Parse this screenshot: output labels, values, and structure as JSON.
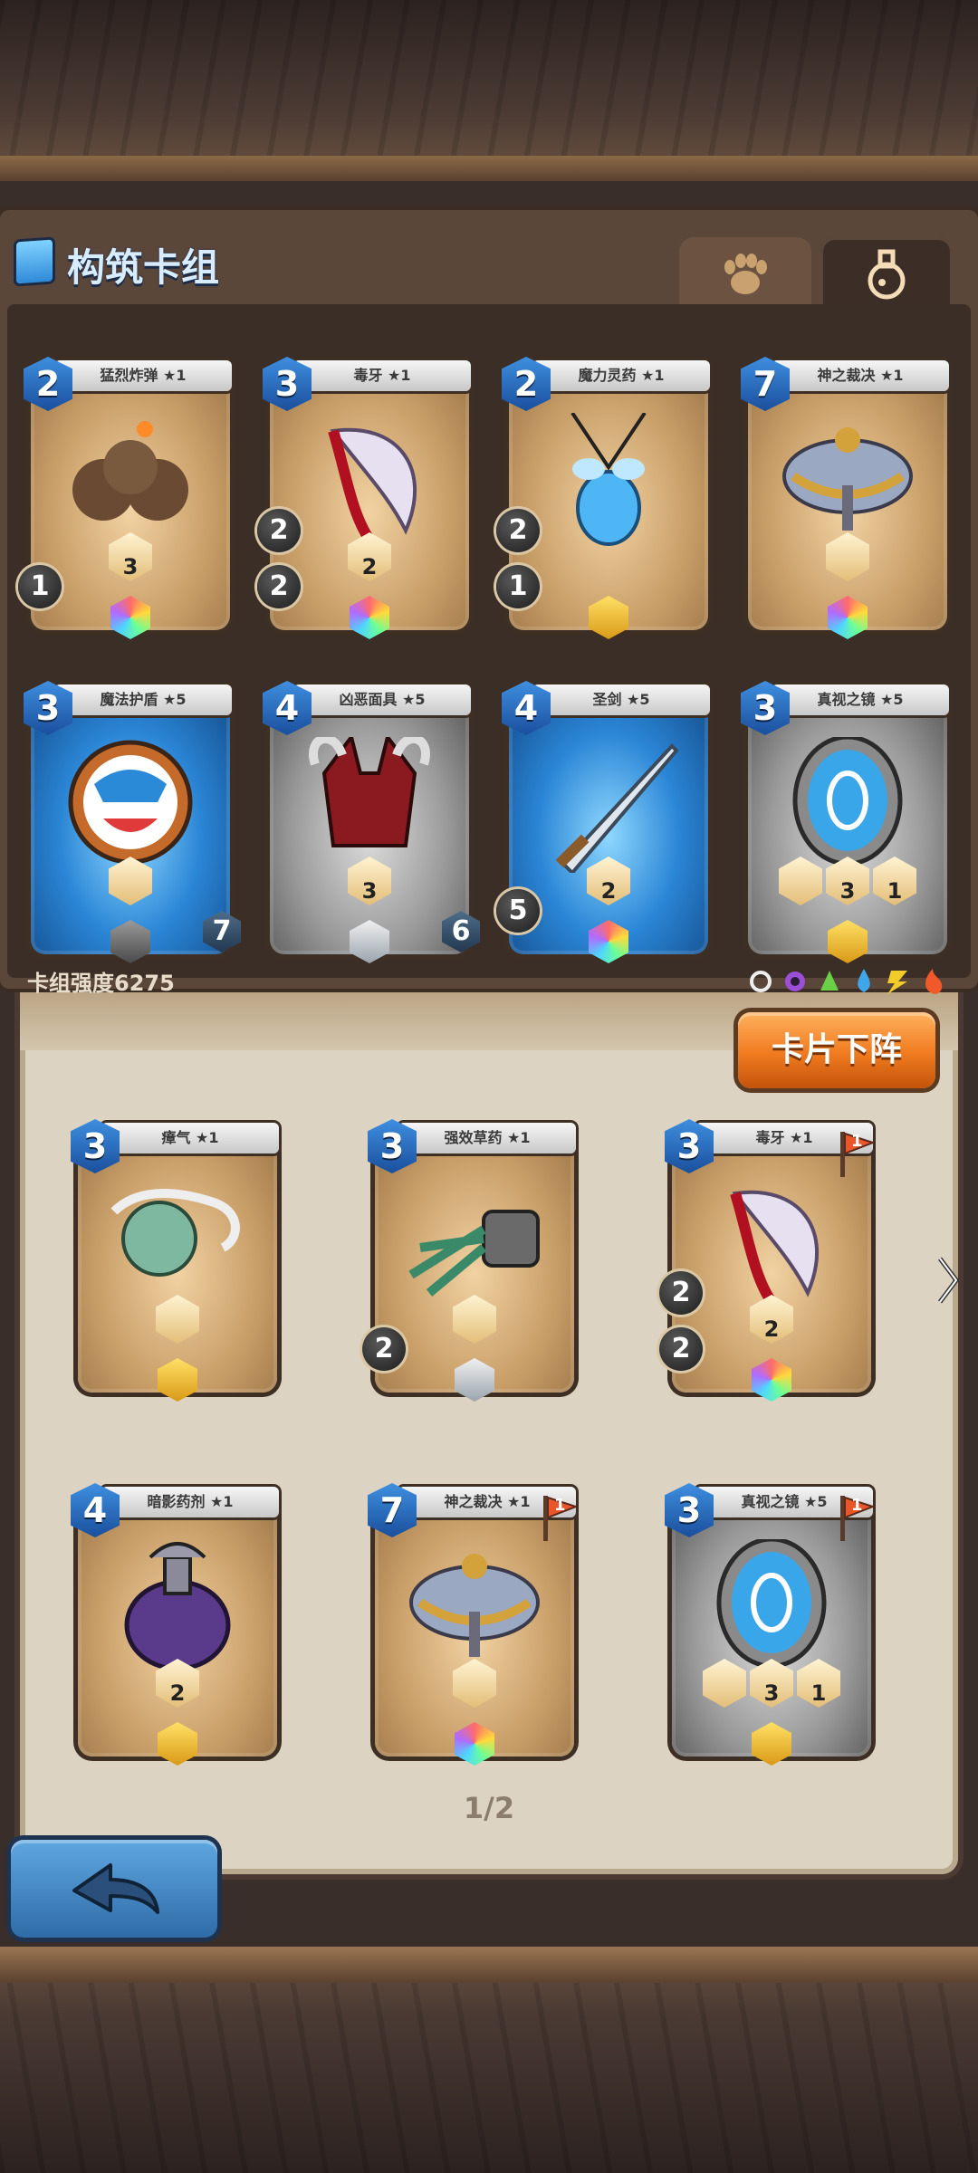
{
  "deck": {
    "title": "构筑卡组",
    "strength": "卡组强度6275",
    "tabs": [
      "paw",
      "potion"
    ],
    "cards": [
      {
        "name": "猛烈炸弹 ★1",
        "cost": "2",
        "frame": "gold",
        "gem": "rainbow",
        "art": "bombs",
        "stats": [
          "3"
        ],
        "left_rounds": [
          "1"
        ]
      },
      {
        "name": "毒牙 ★1",
        "cost": "3",
        "frame": "gold",
        "gem": "rainbow",
        "art": "fang",
        "stats": [
          "2"
        ],
        "left_rounds": [
          "2",
          "2"
        ]
      },
      {
        "name": "魔力灵药 ★1",
        "cost": "2",
        "frame": "gold",
        "gem": "yellow",
        "art": "amulet",
        "stats": [],
        "left_rounds": [
          "2",
          "1"
        ]
      },
      {
        "name": "神之裁决 ★1",
        "cost": "7",
        "frame": "gold",
        "gem": "rainbow",
        "art": "scales",
        "stats": [
          ""
        ],
        "left_rounds": []
      },
      {
        "name": "魔法护盾 ★5",
        "cost": "3",
        "frame": "blue",
        "gem": "darkgray",
        "art": "shield",
        "stats": [
          ""
        ],
        "left_rounds": [],
        "badge": "7"
      },
      {
        "name": "凶恶面具 ★5",
        "cost": "4",
        "frame": "gray",
        "gem": "silver",
        "art": "mask",
        "stats": [
          "3"
        ],
        "left_rounds": [],
        "badge": "6"
      },
      {
        "name": "圣剑 ★5",
        "cost": "4",
        "frame": "blue",
        "gem": "rainbow",
        "art": "sword",
        "stats": [
          "2"
        ],
        "left_rounds": [
          "5"
        ]
      },
      {
        "name": "真视之镜 ★5",
        "cost": "3",
        "frame": "gray",
        "gem": "yellow",
        "art": "mirror",
        "stats": [
          "",
          "3",
          "1"
        ],
        "left_rounds": []
      }
    ]
  },
  "collection": {
    "unload_button": "卡片下阵",
    "pager": "1/2",
    "cards": [
      {
        "name": "瘴气 ★1",
        "cost": "3",
        "frame": "gold",
        "gem": "yellow",
        "art": "cloud",
        "stats": [
          ""
        ],
        "left_rounds": []
      },
      {
        "name": "强效草药 ★1",
        "cost": "3",
        "frame": "gold",
        "gem": "silver",
        "art": "herb",
        "stats": [
          ""
        ],
        "left_rounds": [
          "2"
        ]
      },
      {
        "name": "毒牙 ★1",
        "cost": "3",
        "frame": "gold",
        "gem": "rainbow",
        "art": "fang",
        "stats": [
          "2"
        ],
        "left_rounds": [
          "2",
          "2"
        ],
        "flag": "1"
      },
      {
        "name": "暗影药剂 ★1",
        "cost": "4",
        "frame": "gold",
        "gem": "yellow",
        "art": "potion",
        "stats": [
          "2"
        ],
        "left_rounds": []
      },
      {
        "name": "神之裁决 ★1",
        "cost": "7",
        "frame": "gold",
        "gem": "rainbow",
        "art": "scales",
        "stats": [
          ""
        ],
        "left_rounds": [],
        "flag": "1"
      },
      {
        "name": "真视之镜 ★5",
        "cost": "3",
        "frame": "gray",
        "gem": "yellow",
        "art": "mirror",
        "stats": [
          "",
          "3",
          "1"
        ],
        "left_rounds": [],
        "flag": "1"
      }
    ]
  },
  "elements": [
    "neutral",
    "purple",
    "green",
    "blue",
    "yellow",
    "red"
  ],
  "colors": {
    "accent_orange": "#f07a1f",
    "deck_bg": "#3b2e27",
    "title": "#d7ecff"
  }
}
